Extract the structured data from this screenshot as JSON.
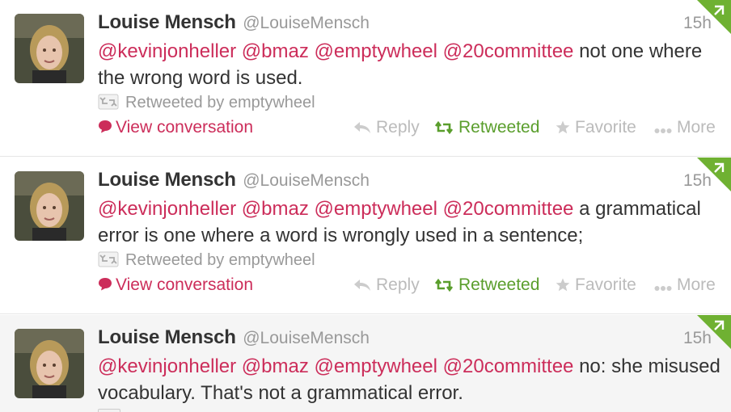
{
  "tweets": [
    {
      "fullname": "Louise Mensch",
      "username": "@LouiseMensch",
      "time": "15h",
      "mentions": [
        "@kevinjonheller",
        "@bmaz",
        "@emptywheel",
        "@20committee"
      ],
      "text": "not one where the wrong word is used.",
      "retweeted_by": "Retweeted by emptywheel",
      "view_conversation": "View conversation",
      "reply": "Reply",
      "retweeted": "Retweeted",
      "favorite": "Favorite",
      "more": "More"
    },
    {
      "fullname": "Louise Mensch",
      "username": "@LouiseMensch",
      "time": "15h",
      "mentions": [
        "@kevinjonheller",
        "@bmaz",
        "@emptywheel",
        "@20committee"
      ],
      "text": "a grammatical error is one where a word is wrongly used in a sentence;",
      "retweeted_by": "Retweeted by emptywheel",
      "view_conversation": "View conversation",
      "reply": "Reply",
      "retweeted": "Retweeted",
      "favorite": "Favorite",
      "more": "More"
    },
    {
      "fullname": "Louise Mensch",
      "username": "@LouiseMensch",
      "time": "15h",
      "mentions": [
        "@kevinjonheller",
        "@bmaz",
        "@emptywheel",
        "@20committee"
      ],
      "text": "no: she misused vocabulary. That's not a grammatical error."
    }
  ],
  "colors": {
    "mention": "#cc2d5a",
    "retweeted": "#5a9e2c",
    "muted": "#999999",
    "hover_bg": "#f5f5f5"
  },
  "icons": [
    "retweet-box-icon",
    "speech-bubble-icon",
    "reply-arrow-icon",
    "retweet-icon",
    "star-icon",
    "more-dots-icon",
    "retweet-corner-badge-icon"
  ]
}
